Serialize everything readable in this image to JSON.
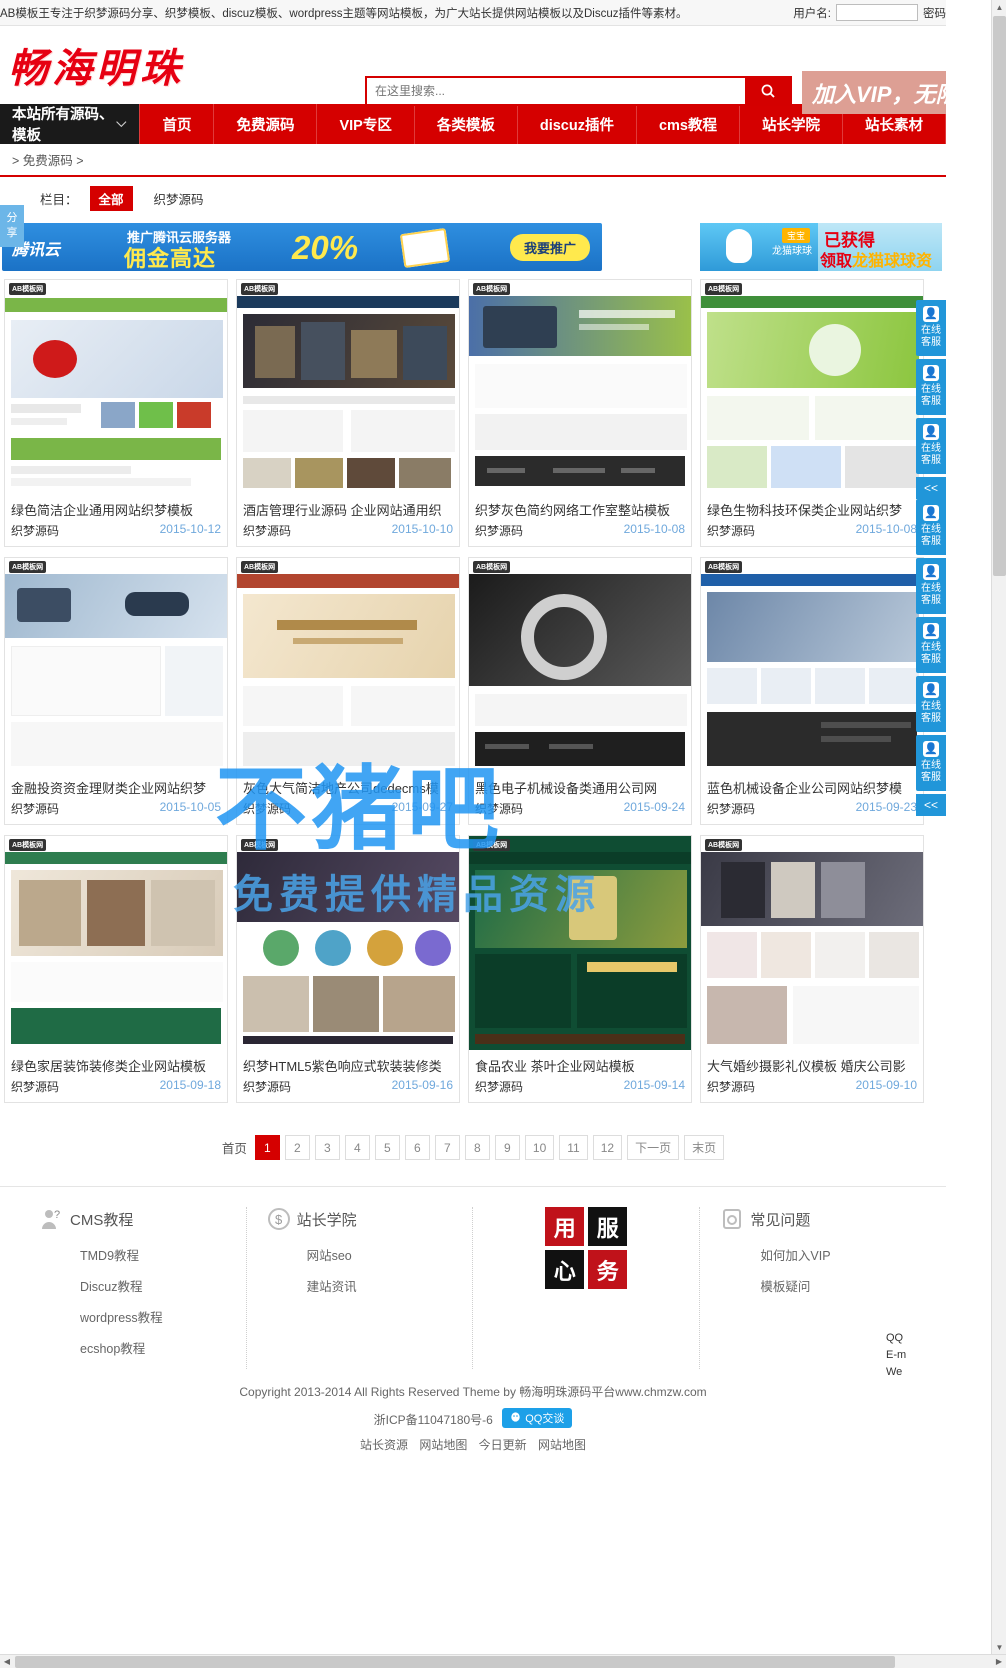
{
  "topbar": {
    "notice": "AB模板王专注于织梦源码分享、织梦模板、discuz模板、wordpress主题等网站模板，为广大站长提供网站模板以及Discuz插件等素材。",
    "username_label": "用户名:",
    "username_value": "",
    "password_label": "密码"
  },
  "header": {
    "logo": "畅海明珠",
    "search_placeholder": "在这里搜索...",
    "search_value": "",
    "search_icon": "search-icon",
    "vip_text": "加入VIP，无限"
  },
  "nav": {
    "all_categories": "本站所有源码、模板",
    "chevron": "chevron-down-icon",
    "items": [
      {
        "label": "首页"
      },
      {
        "label": "免费源码"
      },
      {
        "label": "VIP专区"
      },
      {
        "label": "各类模板"
      },
      {
        "label": "discuz插件"
      },
      {
        "label": "cms教程"
      },
      {
        "label": "站长学院"
      },
      {
        "label": "站长素材"
      }
    ]
  },
  "breadcrumb": {
    "text": "> 免费源码 >"
  },
  "share_tab": {
    "line1": "分",
    "line2": "享"
  },
  "filter": {
    "label": "栏目：",
    "options": [
      {
        "label": "全部",
        "active": true
      },
      {
        "label": "织梦源码",
        "active": false
      }
    ]
  },
  "ads": {
    "left": {
      "brand": "腾讯云",
      "line1": "推广腾讯云服务器",
      "line2": "佣金高达",
      "percent": "20%",
      "cta": "我要推广"
    },
    "right": {
      "tag": "宝宝",
      "sub": "龙猫球球",
      "line1": "已获得",
      "line2_prefix": "领取",
      "line2_highlight": "龙猫球球资格"
    }
  },
  "products": [
    {
      "title": "绿色简洁企业通用网站织梦模板",
      "cat": "织梦源码",
      "date": "2015-10-12"
    },
    {
      "title": "酒店管理行业源码 企业网站通用织",
      "cat": "织梦源码",
      "date": "2015-10-10"
    },
    {
      "title": "织梦灰色简约网络工作室整站模板",
      "cat": "织梦源码",
      "date": "2015-10-08"
    },
    {
      "title": "绿色生物科技环保类企业网站织梦",
      "cat": "织梦源码",
      "date": "2015-10-08"
    },
    {
      "title": "金融投资资金理财类企业网站织梦",
      "cat": "织梦源码",
      "date": "2015-10-05"
    },
    {
      "title": "灰色大气简洁地产公司dedecms模",
      "cat": "织梦源码",
      "date": "2015-09-27"
    },
    {
      "title": "黑色电子机械设备类通用公司网",
      "cat": "织梦源码",
      "date": "2015-09-24"
    },
    {
      "title": "蓝色机械设备企业公司网站织梦模",
      "cat": "织梦源码",
      "date": "2015-09-23"
    },
    {
      "title": "绿色家居装饰装修类企业网站模板",
      "cat": "织梦源码",
      "date": "2015-09-18"
    },
    {
      "title": "织梦HTML5紫色响应式软装装修类",
      "cat": "织梦源码",
      "date": "2015-09-16"
    },
    {
      "title": "食品农业 茶叶企业网站模板",
      "cat": "织梦源码",
      "date": "2015-09-14"
    },
    {
      "title": "大气婚纱摄影礼仪模板 婚庆公司影",
      "cat": "织梦源码",
      "date": "2015-09-10"
    }
  ],
  "pagination": {
    "first": "首页",
    "pages": [
      "1",
      "2",
      "3",
      "4",
      "5",
      "6",
      "7",
      "8",
      "9",
      "10",
      "11",
      "12"
    ],
    "current": "1",
    "next": "下一页",
    "last": "末页"
  },
  "footer": {
    "columns": [
      {
        "icon": "user-question-icon",
        "title": "CMS教程",
        "links": [
          "TMD9教程",
          "Discuz教程",
          "wordpress教程",
          "ecshop教程"
        ]
      },
      {
        "icon": "dollar-circle-icon",
        "title": "站长学院",
        "links": [
          "网站seo",
          "建站资讯"
        ]
      },
      {
        "icon": "faq-icon",
        "title": "常见问题",
        "links": [
          "如何加入VIP",
          "模板疑问"
        ]
      }
    ],
    "slogan_tiles": [
      {
        "char": "用",
        "bg": "#c0121a",
        "fg": "#ffffff"
      },
      {
        "char": "服",
        "bg": "#111111",
        "fg": "#ffffff"
      },
      {
        "char": "心",
        "bg": "#111111",
        "fg": "#ffffff"
      },
      {
        "char": "务",
        "bg": "#c0121a",
        "fg": "#ffffff"
      }
    ],
    "copyright": "Copyright 2013-2014 All Rights Reserved Theme by 畅海明珠源码平台www.chmzw.com",
    "icp": "浙ICP备11047180号-6",
    "qq_badge": "QQ交谈",
    "bottom_links": [
      "站长资源",
      "网站地图",
      "今日更新",
      "网站地图"
    ]
  },
  "service_rail": {
    "buttons": [
      {
        "label": "在线客服"
      },
      {
        "label": "在线客服"
      },
      {
        "label": "在线客服"
      },
      {
        "label": "在线客服"
      },
      {
        "label": "在线客服"
      },
      {
        "label": "在线客服"
      },
      {
        "label": "在线客服"
      },
      {
        "label": "在线客服"
      }
    ],
    "collapse": "<<",
    "qq_info": [
      "QQ",
      "E-m",
      "We"
    ]
  },
  "watermark": {
    "big": "不猪吧",
    "sub": "免费提供精品资源"
  },
  "colors": {
    "brand_red": "#d50000",
    "nav_dark": "#1a1a1a",
    "date_blue": "#6fa8dc",
    "service_blue": "#2196d9"
  }
}
